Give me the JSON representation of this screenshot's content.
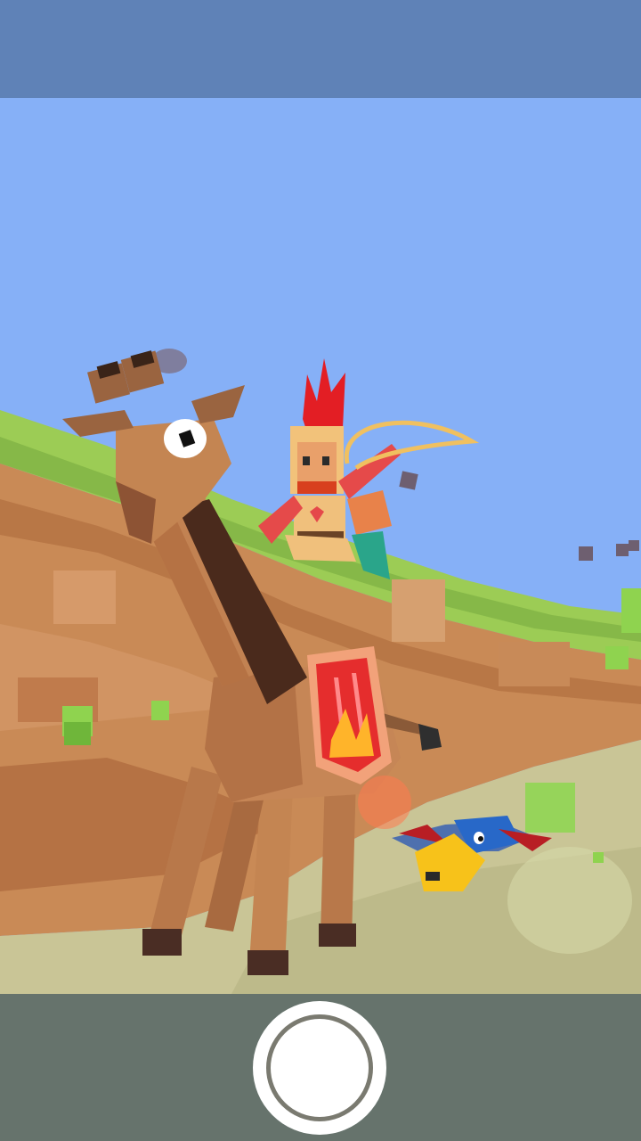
{
  "screen": {
    "top_bar_color": "#5f82b7",
    "sky_color": "#86b0f7",
    "bottom_bar_color": "#606854"
  },
  "scene": {
    "characters": [
      "giraffe",
      "rider-with-lasso",
      "toucan"
    ],
    "environment": "voxel-canyon"
  },
  "controls": {
    "capture_button_icon": "shutter-circle-icon"
  }
}
